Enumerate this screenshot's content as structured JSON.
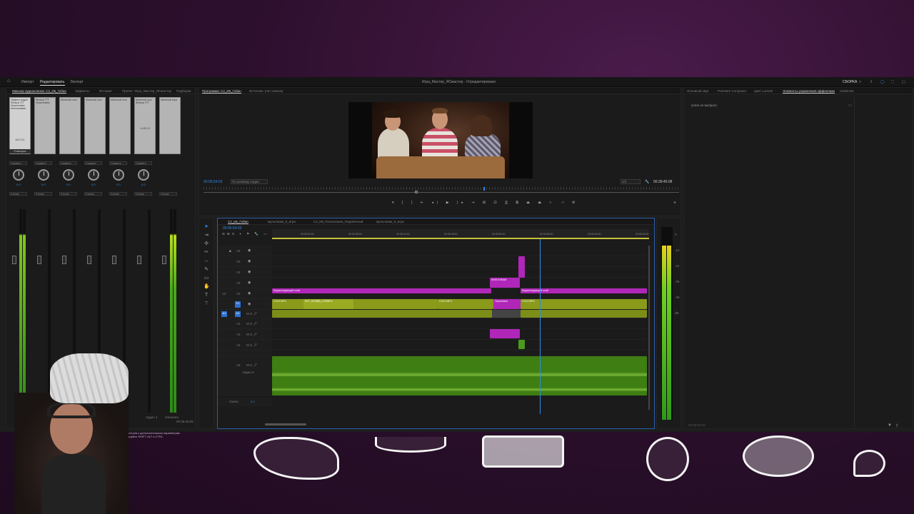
{
  "top_menu": {
    "home_icon": "home-icon",
    "items": [
      "Импорт",
      "Редактировать",
      "Экспорт"
    ],
    "active": "Редактировать",
    "title": "Игра_Мастер_ЯСмастер - Отредактировано",
    "right_label": "СБОРКА"
  },
  "left_panel": {
    "tabs": [
      "Микшер аудиоклипов: C2_Ив_Гобин",
      "Эффекты",
      "История",
      "Проект: Игра_Мастер_ЯСмастер",
      "Подборки"
    ],
    "strip_labels": [
      "Эффект видео Фильтр ГТТ Носителяни Использован",
      "Фильтр ГТТ Носителяни",
      "Минтный лост",
      "Минтный лост",
      "Минтный лост",
      "Минтный лост",
      "Минтный лост Фильтр ГТТ",
      "Минтный игра"
    ],
    "strip_values": [
      "63.2 0.0",
      "",
      "",
      "",
      "",
      "",
      "-0.45 0.0",
      ""
    ],
    "strip_active": "Стиснуть",
    "dropdown_label": "Сжимать",
    "mode_label": "Чтение",
    "knob_value": "0.0",
    "bottom_labels": [
      "Аудио 1",
      "Смешать"
    ],
    "bottom_time": "00:39:45:08",
    "meter_ticks": [
      "0",
      "-6",
      "-12",
      "-18",
      "-24",
      "-30",
      "-36",
      "-42",
      "-48",
      "-54",
      "dB"
    ],
    "tip": "Для доступа к дополнительным параметрам используйте SHIFT, ALT и CTRL."
  },
  "program_monitor": {
    "tabs": [
      "Программа: C2_Ив_Гобин",
      "Источник: (нет клипов)"
    ],
    "timecode": "00:05:54:03",
    "fit_label": "По размеру кадра",
    "quality": "1/2",
    "duration": "00:39:45:08",
    "transport_icons": [
      "marker-icon",
      "in-point-icon",
      "out-point-icon",
      "go-to-in-icon",
      "step-back-icon",
      "play-icon",
      "step-forward-icon",
      "go-to-out-icon",
      "insert-icon",
      "overwrite-icon",
      "export-frame-icon",
      "compare-icon",
      "lift-icon",
      "extract-icon",
      "trim-icon",
      "settings-icon"
    ]
  },
  "timeline": {
    "tabs": [
      "C2_Ив_Гобин",
      "мультикам_6_игра",
      "C2_Ив_Расписания_Подсвечный",
      "мультикам_5_игра"
    ],
    "timecode": "00:05:54:03",
    "ruler": [
      "00:05:30:00",
      "00:05:35:00",
      "00:05:40:00",
      "00:05:45:00",
      "00:05:50:00",
      "00:05:55:00",
      "00:06:00:00",
      "00:06:05:00"
    ],
    "video_tracks": [
      "V6",
      "V5",
      "V4",
      "V3",
      "V2",
      "V1"
    ],
    "audio_tracks": [
      "A1",
      "A2",
      "A3",
      "A4",
      "A5",
      "A6"
    ],
    "audio6_name": "Аудио 6",
    "master_label": "Смеш.",
    "master_value": "0.0",
    "clips": {
      "v3_a": "Корректирующий слой",
      "v3_b": "Корректирующий слой",
      "v4_small": "МУЛЬТИКАМ",
      "v1_a": "CXXX.MP4",
      "v1_b": "SKT_007(ВВ)_1.RSMP4",
      "v1_c": "CXXX.MP4",
      "v1_d": "Переливка",
      "v1_e": "CXXX.MP4"
    }
  },
  "right_panel": {
    "tabs": [
      "Основной звук",
      "Premiere Composer",
      "Цвет Lumetri",
      "Элементы управления эффектами",
      "Свойства"
    ],
    "active": "Элементы управления эффектами",
    "no_clip": "(клип не выбран)",
    "footer_time": "00:05:54:03"
  },
  "colors": {
    "clip_pink": "#b026b9",
    "clip_olive": "#8a9a1a",
    "audio_green": "#3e7e12",
    "accent": "#2d8ceb"
  }
}
